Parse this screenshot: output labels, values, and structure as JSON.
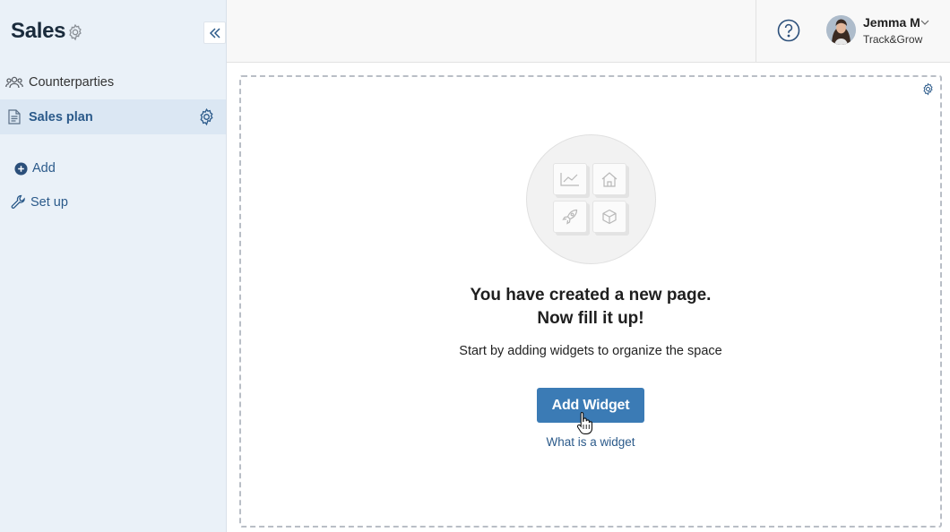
{
  "sidebar": {
    "title": "Sales",
    "items": [
      {
        "label": "Counterparties",
        "icon": "people-icon",
        "active": false
      },
      {
        "label": "Sales plan",
        "icon": "document-icon",
        "active": true
      }
    ],
    "actions": [
      {
        "label": "Add",
        "icon": "plus-circle-icon"
      },
      {
        "label": "Set up",
        "icon": "wrench-icon"
      }
    ]
  },
  "user": {
    "name": "Jemma M",
    "organization": "Track&Grow"
  },
  "main": {
    "headline_line1": "You have created a new page.",
    "headline_line2": "Now fill it up!",
    "subtext": "Start by adding widgets to organize the space",
    "primary_button": "Add Widget",
    "help_link": "What is a widget"
  },
  "colors": {
    "accent": "#3b7bb5",
    "link": "#2b5a8a",
    "sidebar_bg": "#eaf1f8",
    "sidebar_active": "#dbe7f3"
  }
}
